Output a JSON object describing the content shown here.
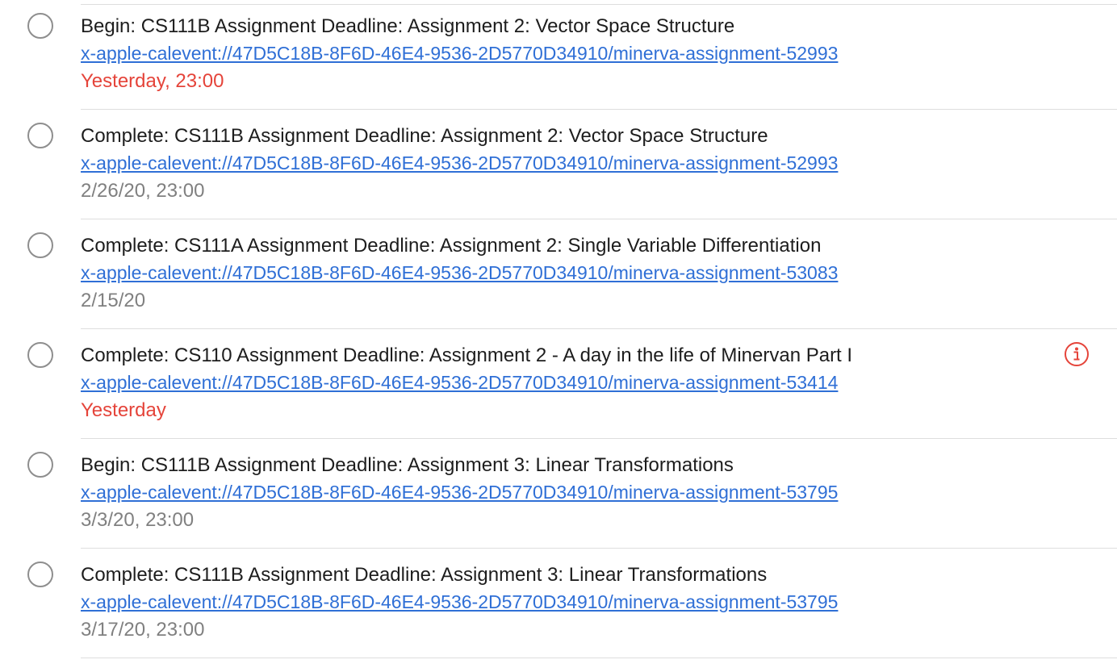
{
  "reminders": [
    {
      "title": "Begin: CS111B Assignment Deadline: Assignment 2: Vector Space Structure",
      "link": "x-apple-calevent://47D5C18B-8F6D-46E4-9536-2D5770D34910/minerva-assignment-52993",
      "due": "Yesterday, 23:00",
      "overdue": true
    },
    {
      "title": "Complete: CS111B Assignment Deadline: Assignment 2: Vector Space Structure",
      "link": "x-apple-calevent://47D5C18B-8F6D-46E4-9536-2D5770D34910/minerva-assignment-52993",
      "due": "2/26/20, 23:00",
      "overdue": false
    },
    {
      "title": "Complete: CS111A Assignment Deadline: Assignment 2: Single Variable Differentiation",
      "link": "x-apple-calevent://47D5C18B-8F6D-46E4-9536-2D5770D34910/minerva-assignment-53083",
      "due": "2/15/20",
      "overdue": false
    },
    {
      "title": "Complete: CS110 Assignment Deadline: Assignment 2 - A day in the life of Minervan Part I",
      "link": "x-apple-calevent://47D5C18B-8F6D-46E4-9536-2D5770D34910/minerva-assignment-53414",
      "due": "Yesterday",
      "overdue": true,
      "show_info": true
    },
    {
      "title": "Begin: CS111B Assignment Deadline: Assignment 3: Linear Transformations",
      "link": "x-apple-calevent://47D5C18B-8F6D-46E4-9536-2D5770D34910/minerva-assignment-53795",
      "due": "3/3/20, 23:00",
      "overdue": false
    },
    {
      "title": "Complete: CS111B Assignment Deadline: Assignment 3: Linear Transformations",
      "link": "x-apple-calevent://47D5C18B-8F6D-46E4-9536-2D5770D34910/minerva-assignment-53795",
      "due": "3/17/20, 23:00",
      "overdue": false
    }
  ],
  "colors": {
    "overdue": "#e5443a",
    "link": "#2f6fd6",
    "info_icon": "#e5443a"
  },
  "icons": {
    "info": "info-icon",
    "checkbox": "checkbox-circle"
  }
}
